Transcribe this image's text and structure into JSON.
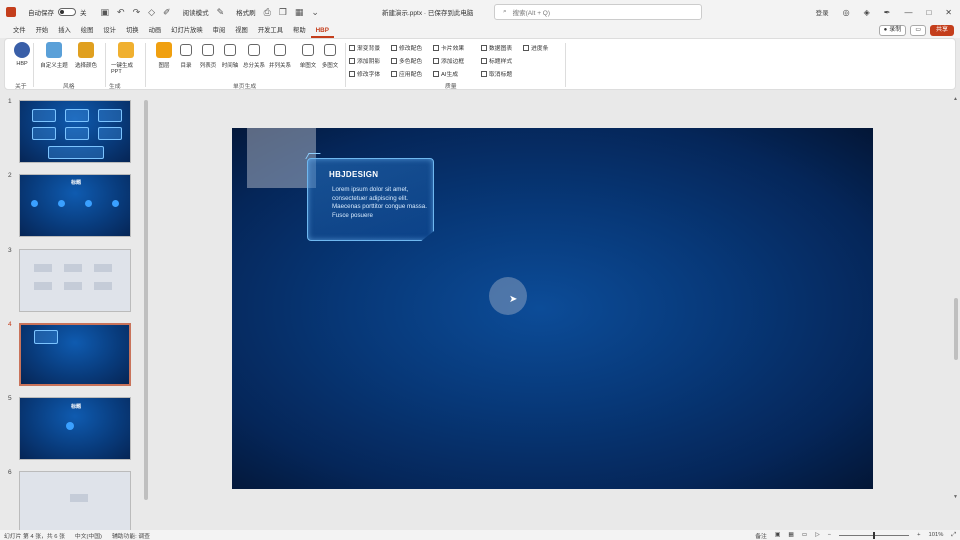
{
  "titlebar": {
    "autosave_label": "自动保存",
    "autosave_state": "关",
    "reading_label": "阅读模式",
    "style_label": "格式刷",
    "doc_title": "新建演示.pptx · 已保存到此电脑",
    "search_placeholder": "搜索(Alt + Q)",
    "user_name": "登录"
  },
  "menu": {
    "tabs": [
      "文件",
      "开始",
      "插入",
      "绘图",
      "设计",
      "切换",
      "动画",
      "幻灯片放映",
      "审阅",
      "视图",
      "开发工具",
      "帮助",
      "HBP"
    ],
    "active_index": 12,
    "record_label": "录制",
    "share_label": "共享"
  },
  "ribbon": {
    "buttons": [
      {
        "label": "HBP",
        "color": "#3a5fa8"
      },
      {
        "label": "自定义主题",
        "color": "#5aa0d8"
      },
      {
        "label": "选择颜色",
        "color": "#e0a020"
      },
      {
        "label": "一键生成PPT",
        "color": "#f0b030"
      },
      {
        "label": "图层",
        "color": "#f0a010"
      },
      {
        "label": "目录",
        "color": "#666666"
      },
      {
        "label": "列表页",
        "color": "#666666"
      },
      {
        "label": "时间轴",
        "color": "#666666"
      },
      {
        "label": "总分关系",
        "color": "#666666"
      },
      {
        "label": "并列关系",
        "color": "#666666"
      },
      {
        "label": "单图文",
        "color": "#666666"
      },
      {
        "label": "多图文",
        "color": "#666666"
      }
    ],
    "groups": [
      "关于",
      "风格",
      "生成",
      "单页生成",
      "质量"
    ],
    "checks": [
      [
        "渐变背景",
        "修改配色",
        "卡片效果",
        "数据图表",
        "进度条"
      ],
      [
        "添加阴影",
        "多色配色",
        "添加边框",
        "标题样式"
      ],
      [
        "修改字体",
        "应用配色",
        "AI生成",
        "取消标题"
      ]
    ]
  },
  "thumbnails": {
    "numbers": [
      "1",
      "2",
      "3",
      "4",
      "5",
      "6"
    ],
    "selected_index": 3,
    "slide2_title": "标题",
    "slide5_title": "标题"
  },
  "slide": {
    "card_title": "HBJDESIGN",
    "card_body": "Lorem ipsum dolor sit amet, consectetuer adipiscing elit. Maecenas porttitor congue massa. Fusce posuere"
  },
  "statusbar": {
    "slide_info": "幻灯片 第 4 张，共 6 张",
    "language": "中文(中国)",
    "accessibility": "辅助功能: 调查",
    "notes_label": "备注",
    "zoom": "101%"
  },
  "colors": {
    "accent": "#c43e1c",
    "slide_dark": "#052659",
    "card_border": "#6fb8f0"
  }
}
